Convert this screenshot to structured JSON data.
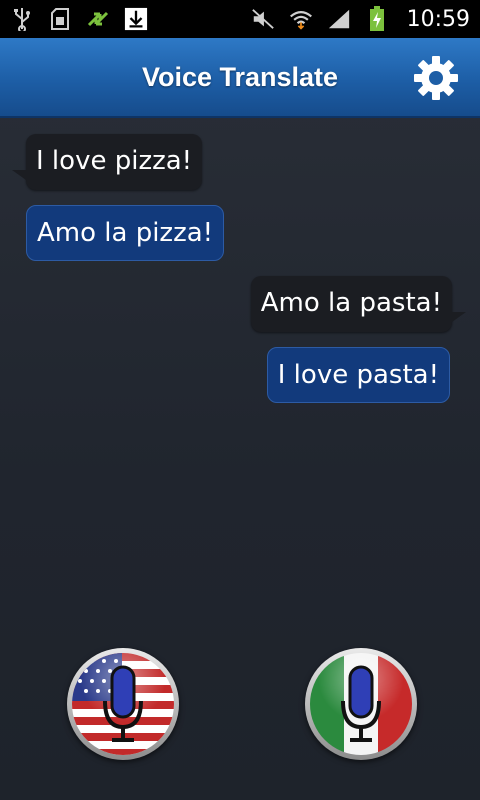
{
  "status_bar": {
    "left_icons": [
      "usb-icon",
      "sd-card-icon",
      "sync-icon",
      "download-icon"
    ],
    "right_icons": [
      "mute-icon",
      "wifi-icon",
      "signal-icon",
      "battery-charging-icon"
    ],
    "time": "10:59"
  },
  "header": {
    "title": "Voice Translate",
    "settings_icon": "gear-icon"
  },
  "messages": [
    {
      "text": "I love pizza!",
      "kind": "source",
      "side": "left"
    },
    {
      "text": "Amo la pizza!",
      "kind": "translation",
      "side": "left"
    },
    {
      "text": "Amo la pasta!",
      "kind": "source",
      "side": "right"
    },
    {
      "text": "I love pasta!",
      "kind": "translation",
      "side": "right"
    }
  ],
  "mic_buttons": [
    {
      "language_flag": "us-flag",
      "icon": "microphone-icon"
    },
    {
      "language_flag": "italy-flag",
      "icon": "microphone-icon"
    }
  ],
  "colors": {
    "header_blue": "#1d5ea6",
    "source_bubble": "#1b1d22",
    "translation_bubble": "#123a7c",
    "mic_blue": "#2f3fb6"
  }
}
